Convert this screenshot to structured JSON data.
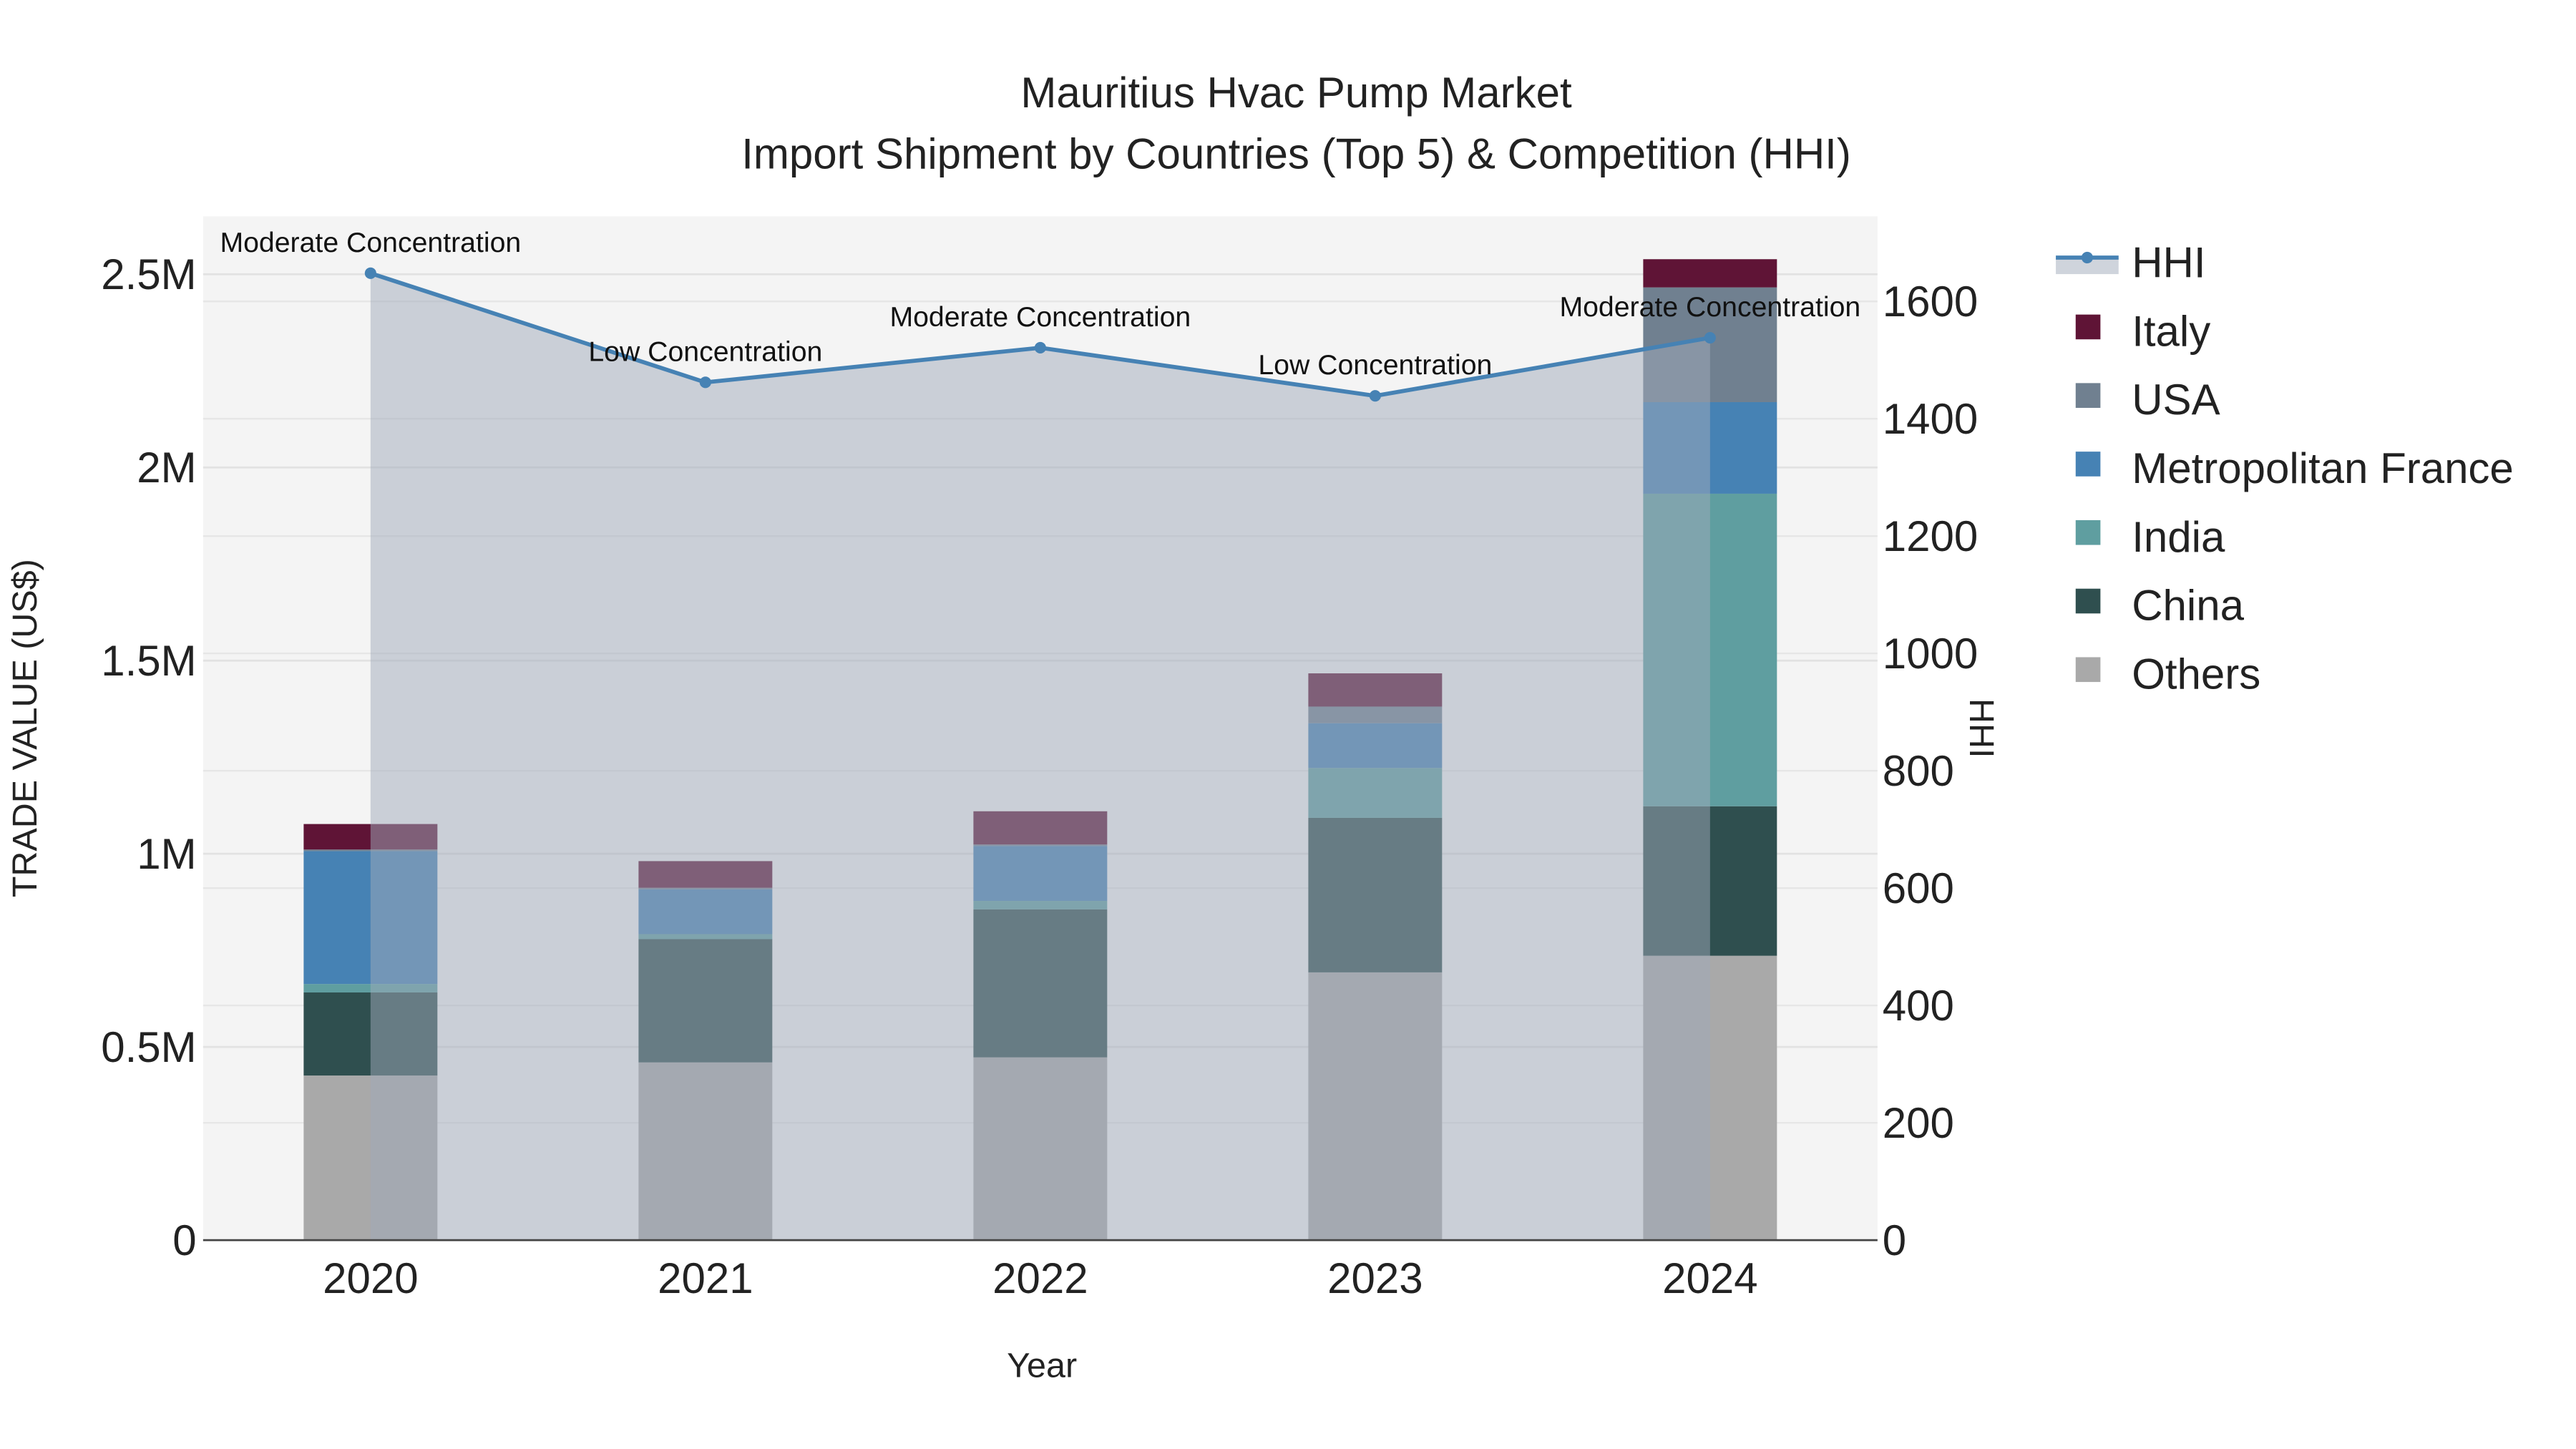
{
  "chart_data": {
    "type": "bar",
    "title": "Mauritius Hvac Pump Market",
    "subtitle": "Import Shipment by Countries (Top 5) & Competition (HHI)",
    "xlabel": "Year",
    "ylabel": "TRADE VALUE (US$)",
    "y2label": "HHI",
    "categories": [
      "2020",
      "2021",
      "2022",
      "2023",
      "2024"
    ],
    "ylim": [
      0,
      2650000
    ],
    "y2lim": [
      0,
      1745
    ],
    "yticks": [
      {
        "v": 0,
        "label": "0"
      },
      {
        "v": 500000,
        "label": "0.5M"
      },
      {
        "v": 1000000,
        "label": "1M"
      },
      {
        "v": 1500000,
        "label": "1.5M"
      },
      {
        "v": 2000000,
        "label": "2M"
      },
      {
        "v": 2500000,
        "label": "2.5M"
      }
    ],
    "y2ticks": [
      0,
      200,
      400,
      600,
      800,
      1000,
      1200,
      1400,
      1600
    ],
    "legend_position": "right",
    "series": [
      {
        "name": "Others",
        "color": "#a9a9a9",
        "values": [
          426000,
          460000,
          473000,
          693000,
          736000
        ]
      },
      {
        "name": "China",
        "color": "#2f4f4f",
        "values": [
          215000,
          319000,
          383000,
          400000,
          387000
        ]
      },
      {
        "name": "India",
        "color": "#5f9ea0",
        "values": [
          22000,
          13000,
          22000,
          129000,
          809000
        ]
      },
      {
        "name": "Metropolitan France",
        "color": "#4682b4",
        "values": [
          344000,
          116000,
          142000,
          116000,
          237000
        ]
      },
      {
        "name": "USA",
        "color": "#708090",
        "values": [
          4000,
          4000,
          4000,
          43000,
          297000
        ]
      },
      {
        "name": "Italy",
        "color": "#5f1436",
        "values": [
          66000,
          69000,
          86000,
          86000,
          73000
        ]
      }
    ],
    "hhi": {
      "name": "HHI",
      "color": "#4682b4",
      "values": [
        1648,
        1462,
        1521,
        1439,
        1538
      ],
      "annotations": [
        "Moderate Concentration",
        "Low Concentration",
        "Moderate Concentration",
        "Low Concentration",
        "Moderate Concentration"
      ]
    },
    "legend_order": [
      "HHI",
      "Italy",
      "USA",
      "Metropolitan France",
      "India",
      "China",
      "Others"
    ]
  }
}
